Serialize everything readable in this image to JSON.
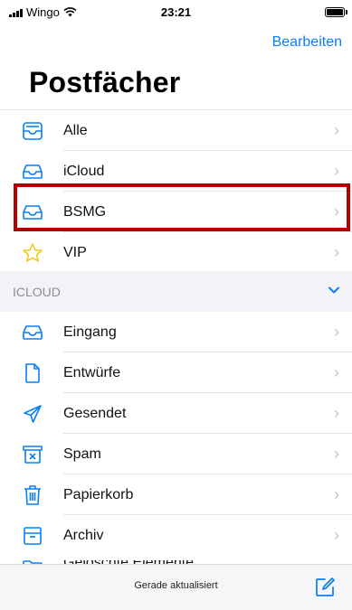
{
  "status_bar": {
    "carrier": "Wingo",
    "time": "23:21"
  },
  "nav": {
    "edit_label": "Bearbeiten",
    "title": "Postfächer"
  },
  "mailboxes": [
    {
      "label": "Alle",
      "icon": "all-inboxes-icon"
    },
    {
      "label": "iCloud",
      "icon": "inbox-tray-icon"
    },
    {
      "label": "BSMG",
      "icon": "inbox-tray-icon"
    },
    {
      "label": "VIP",
      "icon": "star-icon"
    }
  ],
  "icloud_section": {
    "header": "ICLOUD",
    "items": [
      {
        "label": "Eingang",
        "icon": "inbox-tray-icon"
      },
      {
        "label": "Entwürfe",
        "icon": "document-icon"
      },
      {
        "label": "Gesendet",
        "icon": "paper-plane-icon"
      },
      {
        "label": "Spam",
        "icon": "junk-box-icon"
      },
      {
        "label": "Papierkorb",
        "icon": "trash-icon"
      },
      {
        "label": "Archiv",
        "icon": "archive-box-icon"
      }
    ],
    "partial_item": "Gelöschte Elemente"
  },
  "toolbar": {
    "status": "Gerade aktualisiert"
  },
  "colors": {
    "accent": "#0a7ff5",
    "highlight_border": "#b00000",
    "star": "#f5c518"
  }
}
